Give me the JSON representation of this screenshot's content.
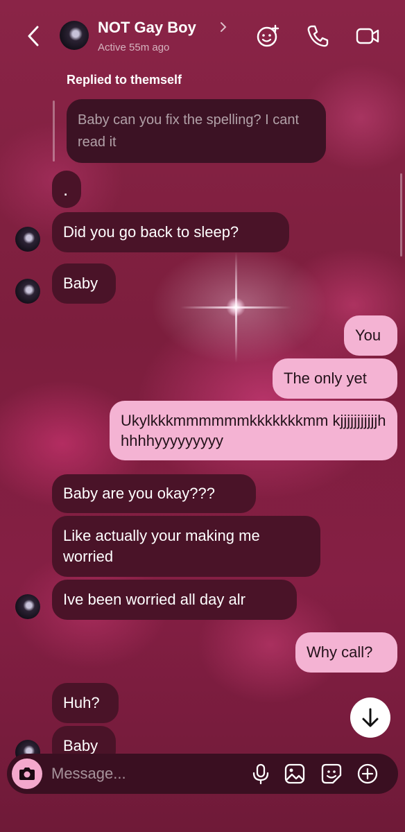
{
  "header": {
    "contact_name": "NOT Gay Boy",
    "status": "Active 55m ago",
    "icons": [
      "back-icon",
      "effects-icon",
      "phone-icon",
      "video-icon"
    ]
  },
  "reply": {
    "label": "Replied to themself",
    "quoted_text": "Baby can you fix the spelling? I cant read it"
  },
  "messages": [
    {
      "sender": "them",
      "text": "."
    },
    {
      "sender": "them",
      "text": "Did you go back to sleep?"
    },
    {
      "sender": "them",
      "text": "Baby"
    },
    {
      "sender": "me",
      "text": "You"
    },
    {
      "sender": "me",
      "text": "The only yet"
    },
    {
      "sender": "me",
      "text": "Ukylkkkmmmmmmkkkkkkkmm kjjjjjjjjjjjhhhhhyyyyyyyyy"
    },
    {
      "sender": "them",
      "text": "Baby are you okay???"
    },
    {
      "sender": "them",
      "text": "Like actually your making me worried"
    },
    {
      "sender": "them",
      "text": "Ive been worried all day alr"
    },
    {
      "sender": "me",
      "text": "Why call?"
    },
    {
      "sender": "them",
      "text": "Huh?"
    },
    {
      "sender": "them",
      "text": "Baby"
    }
  ],
  "composer": {
    "placeholder": "Message...",
    "icons": [
      "camera-icon",
      "microphone-icon",
      "gallery-icon",
      "sticker-icon",
      "plus-icon"
    ]
  },
  "colors": {
    "incoming_bubble": "#4a1328",
    "outgoing_bubble": "#f4b3d3",
    "camera_button": "#f4a8cc"
  }
}
